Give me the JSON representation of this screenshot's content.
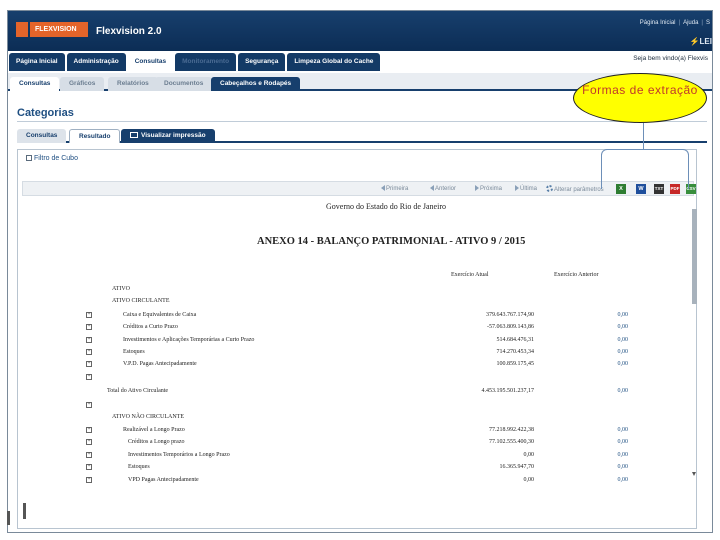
{
  "header": {
    "logo_text": "FLEXVISION",
    "app_title": "Flexvision 2.0",
    "top_links": [
      "Página Inicial",
      "Ajuda",
      "S"
    ],
    "brand_mark": "LEI",
    "welcome": "Seja bem vindo(a) Flexvis"
  },
  "main_nav": [
    {
      "label": "Página Inicial",
      "state": "normal"
    },
    {
      "label": "Administração",
      "state": "normal"
    },
    {
      "label": "Consultas",
      "state": "active"
    },
    {
      "label": "Monitoramento",
      "state": "disabled"
    },
    {
      "label": "Segurança",
      "state": "normal"
    },
    {
      "label": "Limpeza Global do Cache",
      "state": "normal"
    }
  ],
  "sub_nav": [
    {
      "label": "Consultas",
      "state": "active"
    },
    {
      "label": "Gráficos",
      "state": "normal"
    },
    {
      "label": "Relatórios",
      "state": "normal"
    },
    {
      "label": "Documentos",
      "state": "normal"
    },
    {
      "label": "Cabeçalhos e Rodapés",
      "state": "dark"
    }
  ],
  "section_title": "Categorias",
  "view_tabs": {
    "consultas": "Consultas",
    "resultado": "Resultado",
    "visualizar": "Visualizar impressão"
  },
  "filter_label": "Filtro de Cubo",
  "toolbar": {
    "first": "Primeira",
    "previous": "Anterior",
    "next": "Próxima",
    "last": "Última",
    "params": "Alterar parâmetros",
    "export_formats": [
      {
        "icon": "excel-icon",
        "text": "X",
        "color": "#2e7d32"
      },
      {
        "icon": "word-icon",
        "text": "W",
        "color": "#1f4f9c"
      },
      {
        "icon": "text-icon",
        "text": "TXT",
        "color": "#333333"
      },
      {
        "icon": "pdf-icon",
        "text": "PDF",
        "color": "#c62828"
      },
      {
        "icon": "csv-icon",
        "text": "CSV",
        "color": "#388e3c"
      }
    ]
  },
  "report": {
    "government": "Governo do Estado do Rio de Janeiro",
    "title": "ANEXO 14 - BALANÇO PATRIMONIAL - ATIVO 9 / 2015",
    "col_current": "Exercício Atual",
    "col_previous": "Exercício Anterior",
    "rows": [
      {
        "expander": "",
        "label": "ATIVO",
        "current": "",
        "previous": "",
        "indent": 1
      },
      {
        "expander": "",
        "label": "ATIVO CIRCULANTE",
        "current": "",
        "previous": "",
        "indent": 1
      },
      {
        "expander": "+",
        "label": "Caixa e Equivalentes de Caixa",
        "current": "379.643.767.174,90",
        "previous": "0,00",
        "indent": 2
      },
      {
        "expander": "+",
        "label": "Créditos a Curto Prazo",
        "current": "-57.063.809.143,86",
        "previous": "0,00",
        "indent": 2
      },
      {
        "expander": "+",
        "label": "Investimentos e Aplicações Temporárias a Curto Prazo",
        "current": "514.684.476,31",
        "previous": "0,00",
        "indent": 2
      },
      {
        "expander": "+",
        "label": "Estoques",
        "current": "714.270.453,34",
        "previous": "0,00",
        "indent": 2
      },
      {
        "expander": "+",
        "label": "V.P.D. Pagas Antecipadamente",
        "current": "100.859.175,45",
        "previous": "0,00",
        "indent": 2
      },
      {
        "expander": "+",
        "label": "",
        "current": "",
        "previous": "",
        "indent": 2
      },
      {
        "expander": "",
        "label": "Total do Ativo Circulante",
        "current": "4.453.195.501.237,17",
        "previous": "0,00",
        "indent": 0
      },
      {
        "expander": "+",
        "label": "",
        "current": "",
        "previous": "",
        "indent": 1
      },
      {
        "expander": "",
        "label": "ATIVO NÃO CIRCULANTE",
        "current": "",
        "previous": "",
        "indent": 1
      },
      {
        "expander": "+",
        "label": "Realizável a Longo Prazo",
        "current": "77.218.992.422,38",
        "previous": "0,00",
        "indent": 2
      },
      {
        "expander": "+",
        "label": "Créditos a Longo prazo",
        "current": "77.102.555.400,30",
        "previous": "0,00",
        "indent": 3
      },
      {
        "expander": "+",
        "label": "Investimentos Temporários a Longo Prazo",
        "current": "0,00",
        "previous": "0,00",
        "indent": 3
      },
      {
        "expander": "+",
        "label": "Estoques",
        "current": "16.365.947,70",
        "previous": "0,00",
        "indent": 3
      },
      {
        "expander": "+",
        "label": "VPD Pagas Antecipadamente",
        "current": "0,00",
        "previous": "0,00",
        "indent": 3
      }
    ]
  },
  "annotation": {
    "callout_text": "Formas de extração"
  }
}
